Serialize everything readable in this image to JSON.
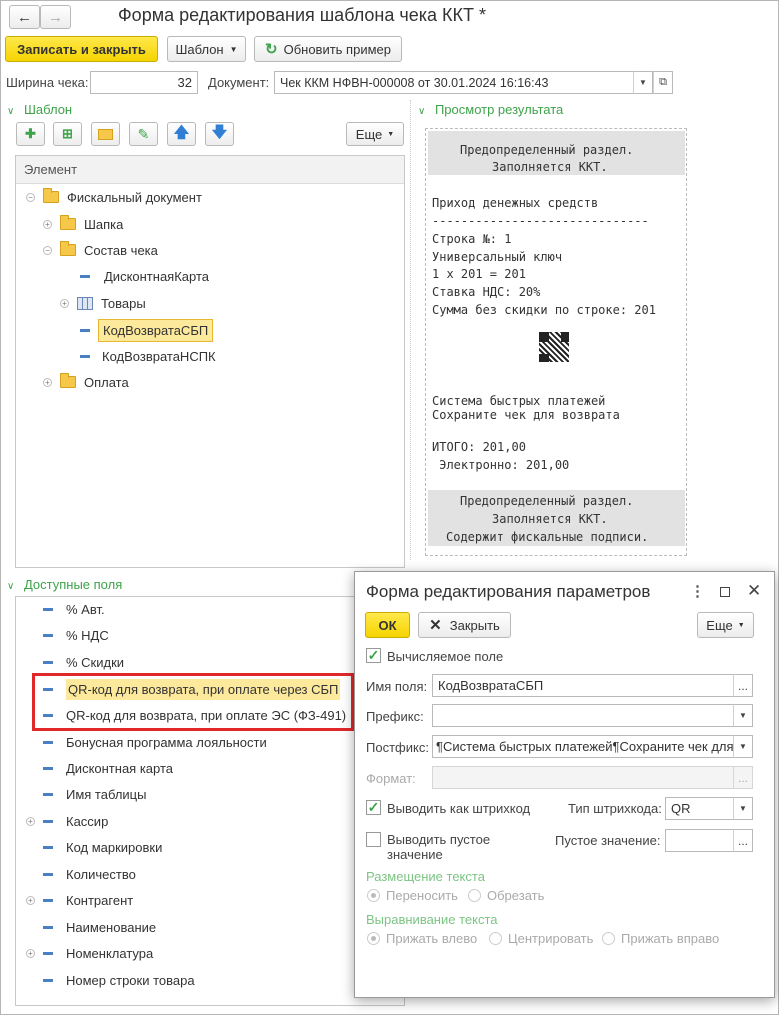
{
  "window": {
    "title": "Форма редактирования шаблона чека ККТ *"
  },
  "toolbar": {
    "save_close": "Записать и закрыть",
    "template": "Шаблон",
    "refresh": "Обновить пример"
  },
  "params": {
    "width_label": "Ширина чека:",
    "width_value": "32",
    "document_label": "Документ:",
    "document_value": "Чек ККМ НФВН-000008 от 30.01.2024 16:16:43"
  },
  "template_section": {
    "title": "Шаблон",
    "more": "Еще",
    "column_header": "Элемент",
    "tree": [
      {
        "label": "Фискальный документ",
        "type": "folder",
        "toggle": "−"
      },
      {
        "label": "Шапка",
        "type": "folder",
        "toggle": "+"
      },
      {
        "label": "Состав чека",
        "type": "folder",
        "toggle": "−"
      },
      {
        "label": "ДисконтнаяКарта",
        "type": "field",
        "toggle": ""
      },
      {
        "label": "Товары",
        "type": "table",
        "toggle": "+"
      },
      {
        "label": "КодВозвратаСБП",
        "type": "field",
        "toggle": "",
        "selected": true
      },
      {
        "label": "КодВозвратаНСПК",
        "type": "field",
        "toggle": ""
      },
      {
        "label": "Оплата",
        "type": "folder",
        "toggle": "+"
      }
    ]
  },
  "preview_section": {
    "title": "Просмотр результата",
    "header_block": [
      "Предопределенный раздел.",
      "Заполняется ККТ."
    ],
    "lines": [
      "Приход денежных средств",
      "------------------------------",
      "Строка №: 1",
      "Универсальный ключ",
      "1 x 201 = 201",
      "Ставка НДС: 20%",
      "Сумма без скидки по строке: 201"
    ],
    "lines_after_qr": [
      "Система быстрых платежей",
      "Сохраните чек для возврата"
    ],
    "total_lines": [
      "ИТОГО: 201,00",
      " Электронно: 201,00"
    ],
    "footer_block": [
      "Предопределенный раздел.",
      "Заполняется ККТ.",
      "Содержит фискальные подписи."
    ]
  },
  "fields_section": {
    "title": "Доступные поля",
    "items": [
      {
        "label": "% Авт.",
        "toggle": ""
      },
      {
        "label": "% НДС",
        "toggle": ""
      },
      {
        "label": "% Скидки",
        "toggle": ""
      },
      {
        "label": "QR-код для возврата, при оплате через СБП",
        "toggle": "",
        "highlighted": true
      },
      {
        "label": "QR-код для возврата, при оплате ЭС (ФЗ-491)",
        "toggle": ""
      },
      {
        "label": "Бонусная программа лояльности",
        "toggle": ""
      },
      {
        "label": "Дисконтная карта",
        "toggle": ""
      },
      {
        "label": "Имя таблицы",
        "toggle": ""
      },
      {
        "label": "Кассир",
        "toggle": "+"
      },
      {
        "label": "Код маркировки",
        "toggle": ""
      },
      {
        "label": "Количество",
        "toggle": ""
      },
      {
        "label": "Контрагент",
        "toggle": "+"
      },
      {
        "label": "Наименование",
        "toggle": ""
      },
      {
        "label": "Номенклатура",
        "toggle": "+"
      },
      {
        "label": "Номер строки товара",
        "toggle": ""
      }
    ]
  },
  "dialog": {
    "title": "Форма редактирования параметров",
    "ok": "ОК",
    "close": "Закрыть",
    "more": "Еще",
    "computed_label": "Вычисляемое поле",
    "computed_checked": true,
    "name_label": "Имя поля:",
    "name_value": "КодВозвратаСБП",
    "prefix_label": "Префикс:",
    "prefix_value": "",
    "postfix_label": "Постфикс:",
    "postfix_value": "¶Система быстрых платежей¶Сохраните чек для",
    "format_label": "Формат:",
    "format_value": "",
    "barcode_label": "Выводить как штрихкод",
    "barcode_checked": true,
    "barcode_type_label": "Тип штрихкода:",
    "barcode_type_value": "QR",
    "empty_label": "Выводить пустое значение",
    "empty_checked": false,
    "empty_value_label": "Пустое значение:",
    "placement_title": "Размещение текста",
    "placement_options": [
      "Переносить",
      "Обрезать"
    ],
    "align_title": "Выравнивание текста",
    "align_options": [
      "Прижать влево",
      "Центрировать",
      "Прижать вправо"
    ]
  },
  "colors": {
    "accent_green": "#3ea34a",
    "yellow_button": "#f5d400",
    "highlight": "#fce99b",
    "red_frame": "#e0282a"
  }
}
